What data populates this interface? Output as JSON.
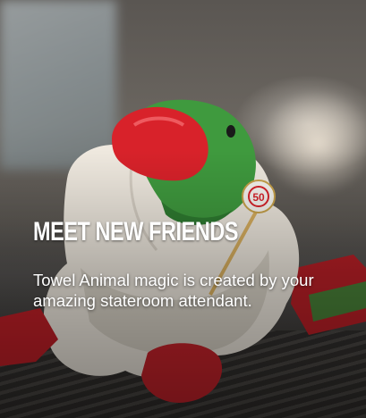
{
  "card": {
    "title": "MEET NEW FRIENDS",
    "description": "Towel Animal magic is created by your amazing stateroom attendant.",
    "image": "towel-animal-bird-photo",
    "badge_text": "50"
  },
  "colors": {
    "title": "#ffffff",
    "description": "#ffffff",
    "towel_white": "#f1ece4",
    "beak_red": "#d8222a",
    "head_green": "#3f9a3e"
  }
}
